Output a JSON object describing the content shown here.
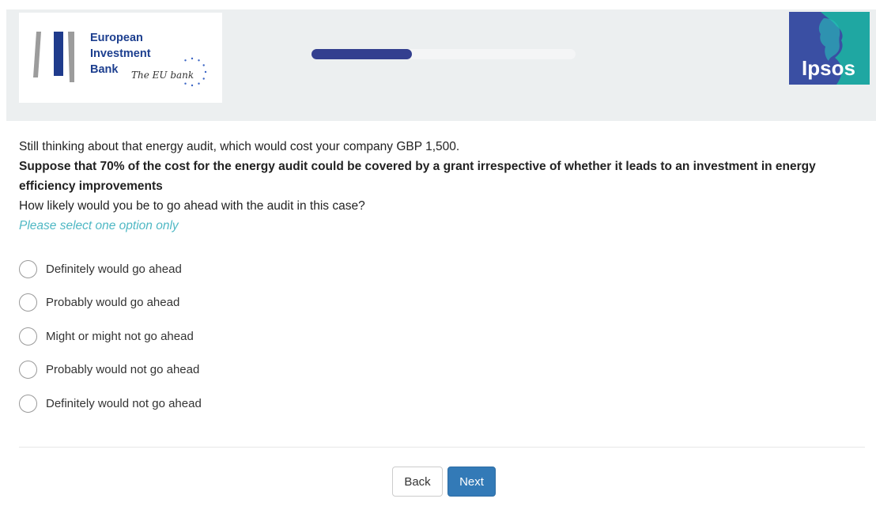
{
  "header": {
    "eib_logo": {
      "line1": "European",
      "line2": "Investment",
      "line3": "Bank",
      "tagline": "The EU bank"
    },
    "progress": {
      "fraction": 0.38
    },
    "ipsos_logo": {
      "text": "Ipsos"
    }
  },
  "question": {
    "intro": "Still thinking about that energy audit, which would cost your company GBP 1,500.",
    "emphasis": "Suppose that 70% of the cost for the energy audit could be covered by a grant irrespective of whether it leads to an investment in energy efficiency improvements",
    "prompt": "How likely would you be to go ahead with the audit in this case?",
    "instruction": "Please select one option only"
  },
  "options": [
    {
      "label": "Definitely would go ahead"
    },
    {
      "label": "Probably would go ahead"
    },
    {
      "label": "Might or might not go ahead"
    },
    {
      "label": "Probably would not go ahead"
    },
    {
      "label": "Definitely would not go ahead"
    }
  ],
  "nav": {
    "back_label": "Back",
    "next_label": "Next"
  },
  "colors": {
    "progress": "#333f8f",
    "instruction": "#4fb8c4",
    "next_button": "#337ab7",
    "eib_text": "#1d3f8f",
    "ipsos": "#3a4fa3"
  }
}
